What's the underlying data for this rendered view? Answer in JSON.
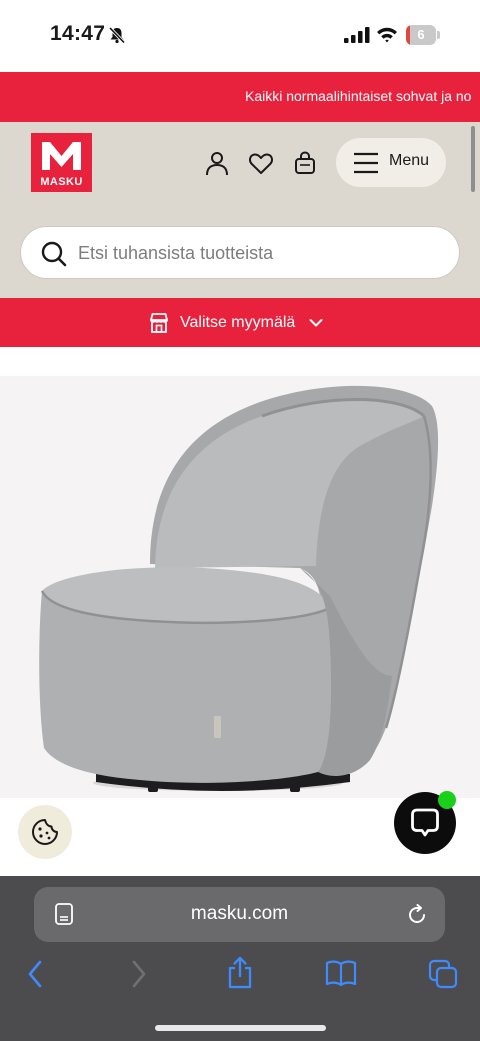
{
  "status_bar": {
    "time": "14:47",
    "battery_level": "6",
    "battery_fraction": 0.06,
    "battery_color": "#e0483f"
  },
  "promo": {
    "text": "Kaikki normaalihintaiset sohvat ja no"
  },
  "header": {
    "logo_text": "MASKU",
    "brand_color": "#e8213d",
    "icons": [
      "user-icon",
      "heart-icon",
      "shopping-bag-icon",
      "hamburger-icon"
    ],
    "menu_label": "Menu"
  },
  "search": {
    "placeholder": "Etsi tuhansista tuotteista",
    "icon": "search-icon"
  },
  "store_picker": {
    "label": "Valitse myymälä",
    "icon": "store-icon",
    "chevron": "chevron-down-icon"
  },
  "product": {
    "image": "grey-swivel-armchair"
  },
  "floating": {
    "cookie_icon": "cookie-icon",
    "chat_icon": "chat-icon",
    "chat_status_color": "#1bd01b"
  },
  "browser": {
    "url": "masku.com",
    "toolbar": [
      "back-icon",
      "forward-icon",
      "share-icon",
      "bookmarks-icon",
      "tabs-icon"
    ]
  }
}
